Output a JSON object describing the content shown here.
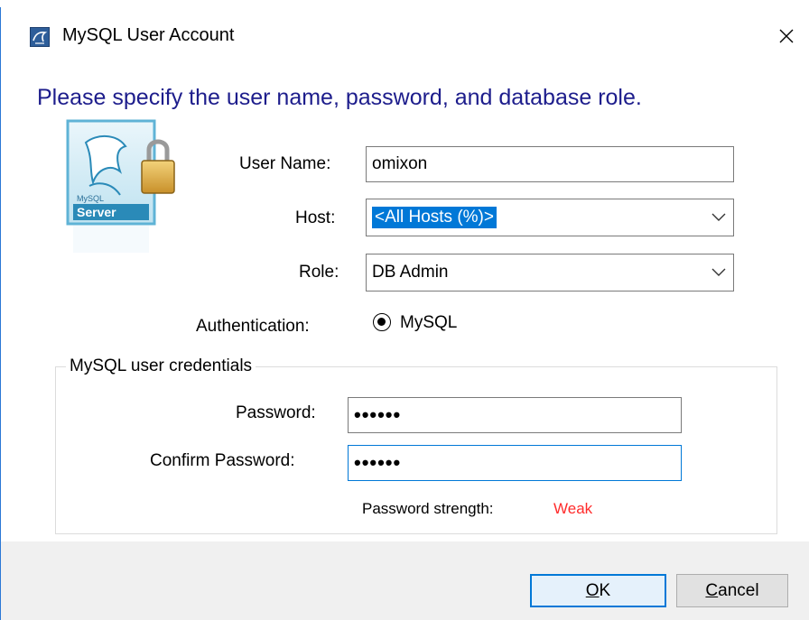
{
  "window": {
    "title": "MySQL User Account",
    "close_glyph": "✕"
  },
  "heading": "Please specify the user name, password, and database role.",
  "logo": {
    "text": "Server",
    "small_text": "MySQL"
  },
  "form": {
    "user_name_label": "User Name:",
    "user_name_value": "omixon",
    "host_label": "Host:",
    "host_value": "<All Hosts (%)>",
    "role_label": "Role:",
    "role_value": "DB Admin",
    "auth_label": "Authentication:",
    "auth_value": "MySQL"
  },
  "credentials": {
    "group_title": "MySQL user credentials",
    "password_label": "Password:",
    "password_value": "••••••",
    "confirm_label": "Confirm Password:",
    "confirm_value": "••••••",
    "strength_label": "Password strength:",
    "strength_value": "Weak"
  },
  "buttons": {
    "ok_mnemonic": "O",
    "ok_rest": "K",
    "cancel_mnemonic": "C",
    "cancel_rest": "ancel"
  },
  "colors": {
    "heading": "#1d1d8c",
    "accent": "#0078d7",
    "weak": "#ff2b2b"
  },
  "icons": [
    "mysql-app-icon",
    "close-icon",
    "mysql-server-lock-logo",
    "chevron-down-icon",
    "radio-selected-icon"
  ]
}
